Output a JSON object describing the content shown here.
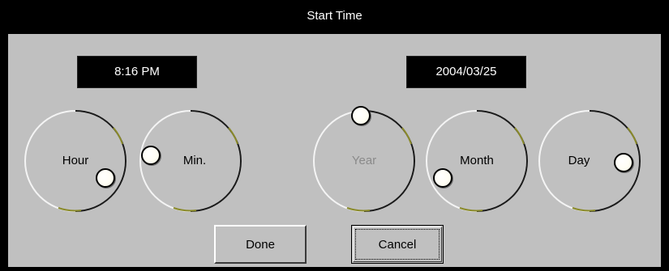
{
  "dialog": {
    "title": "Start Time"
  },
  "readouts": {
    "time": "8:16 PM",
    "date": "2004/03/25"
  },
  "dials": {
    "hour": {
      "label": "Hour",
      "enabled": true
    },
    "min": {
      "label": "Min.",
      "enabled": true
    },
    "year": {
      "label": "Year",
      "enabled": false
    },
    "month": {
      "label": "Month",
      "enabled": true
    },
    "day": {
      "label": "Day",
      "enabled": true
    }
  },
  "buttons": {
    "done": "Done",
    "cancel": "Cancel"
  },
  "colors": {
    "panel": "#c0c0c0",
    "titlebar": "#000000",
    "readout_bg": "#000000",
    "dial_accent": "#8a8a2a",
    "disabled_text": "#8a8a8a"
  }
}
